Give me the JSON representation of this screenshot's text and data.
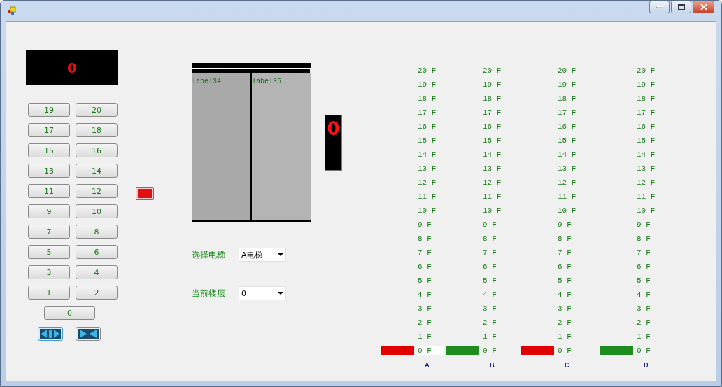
{
  "floor_display": "0",
  "keypad": [
    "19",
    "20",
    "17",
    "18",
    "15",
    "16",
    "13",
    "14",
    "11",
    "12",
    "9",
    "10",
    "7",
    "8",
    "5",
    "6",
    "3",
    "4",
    "1",
    "2"
  ],
  "ground_button": "0",
  "door": {
    "left_label": "label34",
    "right_label": "label35"
  },
  "car_display": "0",
  "fields": [
    {
      "label": "选择电梯",
      "value": "A电梯"
    },
    {
      "label": "当前楼层",
      "value": "0"
    }
  ],
  "shafts": [
    {
      "name": "A",
      "color": "#e00000",
      "floors": [
        {
          "label": "20 F",
          "selected": false
        },
        {
          "label": "19 F",
          "selected": false
        },
        {
          "label": "18 F",
          "selected": false
        },
        {
          "label": "17 F",
          "selected": false
        },
        {
          "label": "16 F",
          "selected": false
        },
        {
          "label": "15 F",
          "selected": false
        },
        {
          "label": "14 F",
          "selected": false
        },
        {
          "label": "13 F",
          "selected": false
        },
        {
          "label": "12 F",
          "selected": false
        },
        {
          "label": "11 F",
          "selected": false
        },
        {
          "label": "10 F",
          "selected": false
        },
        {
          "label": "9 F",
          "selected": false
        },
        {
          "label": "8 F",
          "selected": false
        },
        {
          "label": "7 F",
          "selected": false
        },
        {
          "label": "6 F",
          "selected": false
        },
        {
          "label": "5 F",
          "selected": false
        },
        {
          "label": "4 F",
          "selected": false
        },
        {
          "label": "3 F",
          "selected": false
        },
        {
          "label": "2 F",
          "selected": false
        },
        {
          "label": "1 F",
          "selected": false
        },
        {
          "label": "0 F",
          "selected": true
        }
      ]
    },
    {
      "name": "B",
      "color": "#1e8c1e",
      "floors": [
        {
          "label": "20 F",
          "selected": false
        },
        {
          "label": "19 F",
          "selected": false
        },
        {
          "label": "18 F",
          "selected": false
        },
        {
          "label": "17 F",
          "selected": false
        },
        {
          "label": "16 F",
          "selected": false
        },
        {
          "label": "15 F",
          "selected": false
        },
        {
          "label": "14 F",
          "selected": false
        },
        {
          "label": "13 F",
          "selected": false
        },
        {
          "label": "12 F",
          "selected": false
        },
        {
          "label": "11 F",
          "selected": false
        },
        {
          "label": "10 F",
          "selected": false
        },
        {
          "label": "9 F",
          "selected": false
        },
        {
          "label": "8 F",
          "selected": false
        },
        {
          "label": "7 F",
          "selected": false
        },
        {
          "label": "6 F",
          "selected": false
        },
        {
          "label": "5 F",
          "selected": false
        },
        {
          "label": "4 F",
          "selected": false
        },
        {
          "label": "3 F",
          "selected": false
        },
        {
          "label": "2 F",
          "selected": false
        },
        {
          "label": "1 F",
          "selected": false
        },
        {
          "label": "0 F",
          "selected": false
        }
      ]
    },
    {
      "name": "C",
      "color": "#e00000",
      "floors": [
        {
          "label": "20 F",
          "selected": false
        },
        {
          "label": "19 F",
          "selected": false
        },
        {
          "label": "18 F",
          "selected": false
        },
        {
          "label": "17 F",
          "selected": false
        },
        {
          "label": "16 F",
          "selected": false
        },
        {
          "label": "15 F",
          "selected": false
        },
        {
          "label": "14 F",
          "selected": false
        },
        {
          "label": "13 F",
          "selected": false
        },
        {
          "label": "12 F",
          "selected": false
        },
        {
          "label": "11 F",
          "selected": false
        },
        {
          "label": "10 F",
          "selected": false
        },
        {
          "label": "9 F",
          "selected": false
        },
        {
          "label": "8 F",
          "selected": false
        },
        {
          "label": "7 F",
          "selected": false
        },
        {
          "label": "6 F",
          "selected": false
        },
        {
          "label": "5 F",
          "selected": false
        },
        {
          "label": "4 F",
          "selected": false
        },
        {
          "label": "3 F",
          "selected": false
        },
        {
          "label": "2 F",
          "selected": false
        },
        {
          "label": "1 F",
          "selected": false
        },
        {
          "label": "0 F",
          "selected": false
        }
      ]
    },
    {
      "name": "D",
      "color": "#1e8c1e",
      "floors": [
        {
          "label": "20 F",
          "selected": false
        },
        {
          "label": "19 F",
          "selected": false
        },
        {
          "label": "18 F",
          "selected": false
        },
        {
          "label": "17 F",
          "selected": false
        },
        {
          "label": "16 F",
          "selected": false
        },
        {
          "label": "15 F",
          "selected": false
        },
        {
          "label": "14 F",
          "selected": false
        },
        {
          "label": "13 F",
          "selected": false
        },
        {
          "label": "12 F",
          "selected": false
        },
        {
          "label": "11 F",
          "selected": false
        },
        {
          "label": "10 F",
          "selected": false
        },
        {
          "label": "9 F",
          "selected": false
        },
        {
          "label": "8 F",
          "selected": false
        },
        {
          "label": "7 F",
          "selected": false
        },
        {
          "label": "6 F",
          "selected": false
        },
        {
          "label": "5 F",
          "selected": false
        },
        {
          "label": "4 F",
          "selected": false
        },
        {
          "label": "3 F",
          "selected": false
        },
        {
          "label": "2 F",
          "selected": false
        },
        {
          "label": "1 F",
          "selected": false
        },
        {
          "label": "0 F",
          "selected": false
        }
      ]
    }
  ]
}
